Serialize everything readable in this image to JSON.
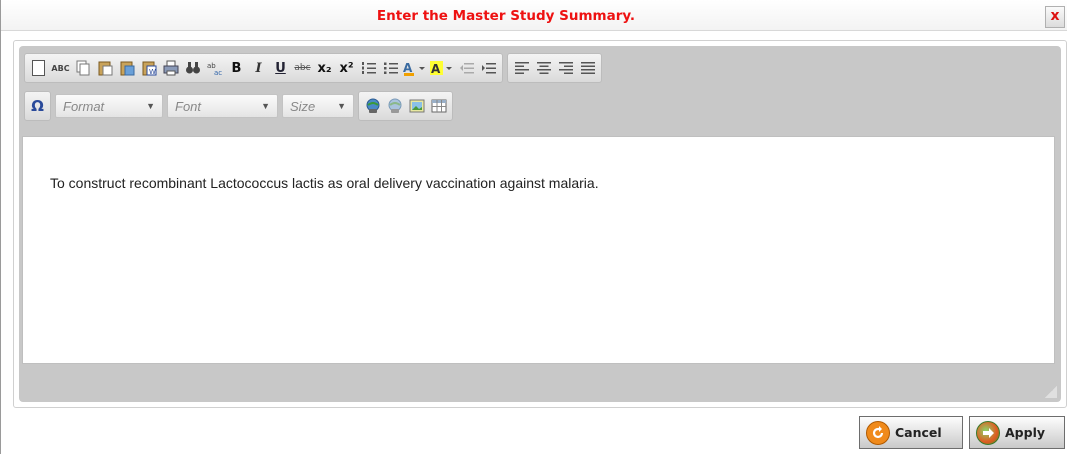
{
  "dialog": {
    "title": "Enter the Master Study Summary.",
    "close_label": "x",
    "title_color": "#ee1111"
  },
  "toolbar": {
    "row1_group1": [
      "new-page-icon",
      "spell-check-icon",
      "copy-icon",
      "paste-icon",
      "paste-text-icon",
      "paste-word-icon",
      "print-icon",
      "find-icon",
      "replace-icon",
      "bold-icon",
      "italic-icon",
      "underline-icon",
      "strikethrough-icon",
      "subscript-icon",
      "superscript-icon",
      "numbered-list-icon",
      "bullet-list-icon",
      "text-color-icon",
      "background-color-icon",
      "outdent-icon",
      "indent-icon"
    ],
    "row1_group2": [
      "align-left-icon",
      "align-center-icon",
      "align-right-icon",
      "justify-icon"
    ],
    "labels": {
      "spell": "ABC",
      "bold": "B",
      "italic": "I",
      "underline": "U",
      "strike": "abc",
      "sub": "x₂",
      "sup": "x²",
      "special_char": "Ω"
    },
    "format_placeholder": "Format",
    "font_placeholder": "Font",
    "size_placeholder": "Size",
    "row2_group2": [
      "link-icon",
      "unlink-icon",
      "image-icon",
      "table-icon"
    ]
  },
  "editor": {
    "content": "To construct recombinant Lactococcus lactis as oral delivery vaccination against malaria."
  },
  "buttons": {
    "cancel_label": "Cancel",
    "apply_label": "Apply"
  },
  "colors": {
    "cancel_icon": "#f08a1a",
    "apply_icon": "#4caf3a"
  }
}
